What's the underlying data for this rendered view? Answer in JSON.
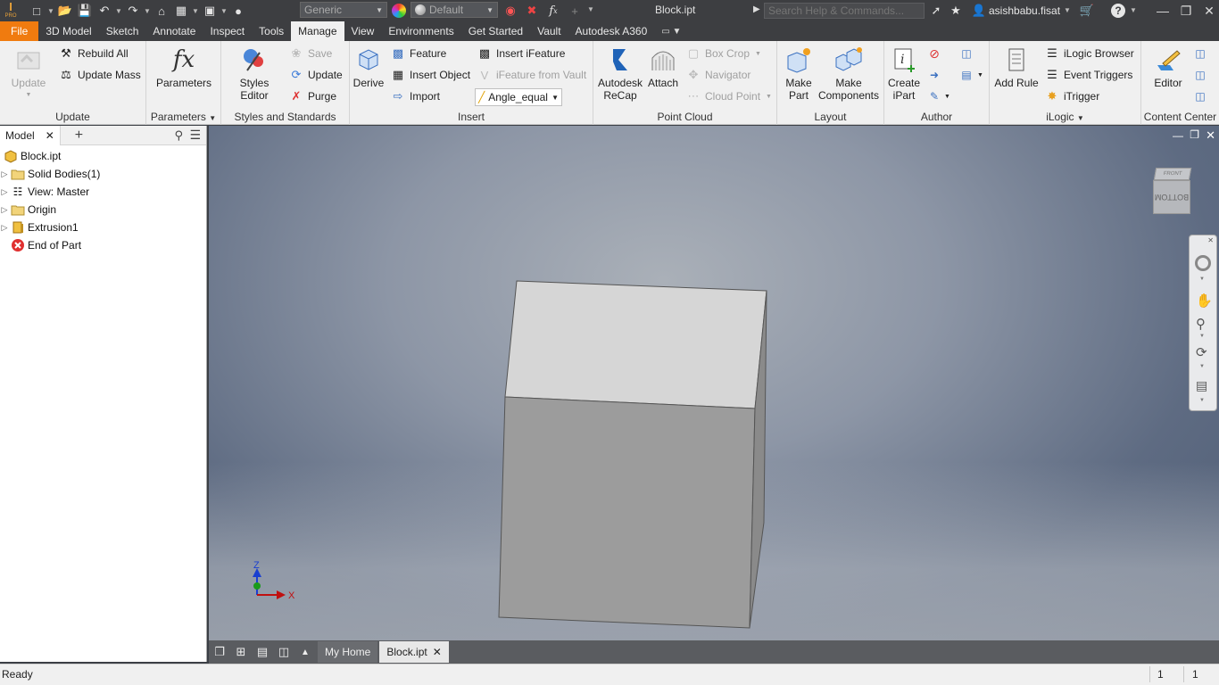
{
  "titlebar": {
    "app_logo": "I",
    "app_logo_sub": "PRO",
    "material_combo": "Generic",
    "appearance_combo": "Default",
    "doc_title": "Block.ipt",
    "search_placeholder": "Search Help & Commands...",
    "user_name": "asishbabu.fisat"
  },
  "tabs": [
    "File",
    "3D Model",
    "Sketch",
    "Annotate",
    "Inspect",
    "Tools",
    "Manage",
    "View",
    "Environments",
    "Get Started",
    "Vault",
    "Autodesk A360"
  ],
  "active_tab": "Manage",
  "ribbon": {
    "update": {
      "title": "Update",
      "update_label": "Update",
      "rebuild_all": "Rebuild All",
      "update_mass": "Update Mass"
    },
    "parameters": {
      "title": "Parameters",
      "parameters_label": "Parameters",
      "fx_symbol": "fx"
    },
    "styles": {
      "title": "Styles and Standards",
      "styles_editor": "Styles Editor",
      "save": "Save",
      "update": "Update",
      "purge": "Purge"
    },
    "insert": {
      "title": "Insert",
      "derive": "Derive",
      "feature": "Feature",
      "insert_object": "Insert Object",
      "import": "Import",
      "insert_ifeature": "Insert iFeature",
      "ifeature_from_vault": "iFeature from Vault",
      "combo_value": "Angle_equal"
    },
    "point_cloud": {
      "title": "Point Cloud",
      "recap_line1": "Autodesk",
      "recap_line2": "ReCap",
      "attach": "Attach",
      "box_crop": "Box Crop",
      "navigator": "Navigator",
      "cloud_point": "Cloud Point"
    },
    "layout": {
      "title": "Layout",
      "make_part_1": "Make",
      "make_part_2": "Part",
      "make_comp_1": "Make",
      "make_comp_2": "Components"
    },
    "author": {
      "title": "Author",
      "create_ipart_1": "Create",
      "create_ipart_2": "iPart"
    },
    "ilogic": {
      "title": "iLogic",
      "add_rule": "Add Rule",
      "ilogic_browser": "iLogic Browser",
      "event_triggers": "Event Triggers",
      "itrigger": "iTrigger"
    },
    "content_center": {
      "title": "Content Center",
      "editor": "Editor"
    }
  },
  "browser": {
    "tab_label": "Model",
    "items": [
      {
        "label": "Block.ipt"
      },
      {
        "label": "Solid Bodies(1)"
      },
      {
        "label": "View: Master"
      },
      {
        "label": "Origin"
      },
      {
        "label": "Extrusion1"
      },
      {
        "label": "End of Part"
      }
    ]
  },
  "viewcube": {
    "face_top": "FRONT",
    "face_front": "BOTTOM"
  },
  "triad": {
    "z_label": "Z",
    "x_label": "X"
  },
  "doctabs": {
    "home": "My Home",
    "active": "Block.ipt"
  },
  "status": {
    "text": "Ready",
    "count1": "1",
    "count2": "1"
  },
  "colors": {
    "file_tab": "#f07b0f",
    "title_bar": "#3d3e41",
    "ribbon_bg": "#f0f0f0"
  }
}
